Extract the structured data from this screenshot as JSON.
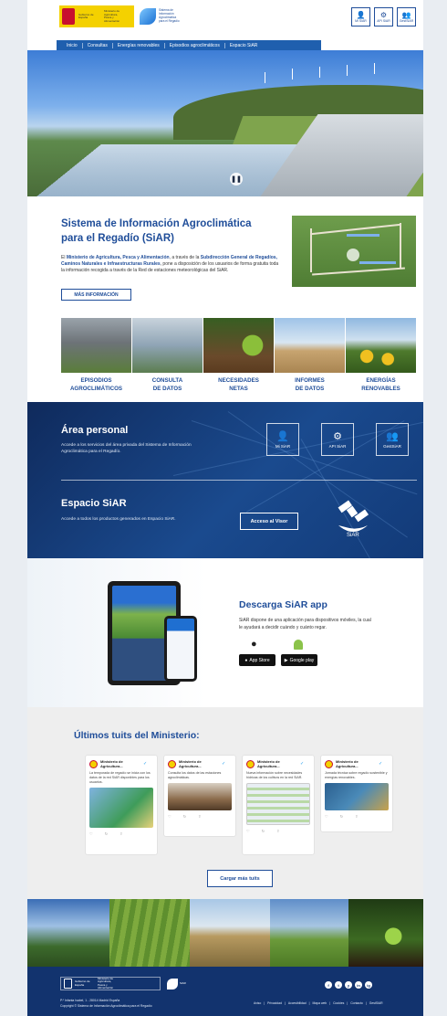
{
  "header": {
    "gov_logo_text": "Gobierno de España",
    "ministry_text": "Ministerio de Agricultura, Pesca y Alimentación",
    "siar_logo_text": "Sistema de Información Agroclimática para el Regadío",
    "buttons": [
      {
        "icon": "user-icon",
        "label": "Mi SiAR"
      },
      {
        "icon": "api-icon",
        "label": "API SiAR"
      },
      {
        "icon": "group-icon",
        "label": "GestSiAR"
      }
    ]
  },
  "nav": {
    "items": [
      "Inicio",
      "Consultas",
      "Energías renovables",
      "Episodios agroclimáticos",
      "Espacio SiAR"
    ]
  },
  "intro": {
    "title": "Sistema de Información Agroclimática para el Regadío (SiAR)",
    "text_parts": [
      "El ",
      "Ministerio de Agricultura, Pesca y Alimentación",
      ", a través de la ",
      "Subdirección General de Regadíos, Caminos Naturales e Infraestructuras Rurales",
      ", pone a disposición de los usuarios de forma gratuita toda la información recogida a través de la Red de estaciones meteorológicas del SiAR."
    ],
    "more_button": "MÁS INFORMACIÓN"
  },
  "categories": [
    {
      "label1": "EPISODIOS",
      "label2": "AGROCLIMÁTICOS"
    },
    {
      "label1": "CONSULTA",
      "label2": "DE DATOS"
    },
    {
      "label1": "NECESIDADES",
      "label2": "NETAS"
    },
    {
      "label1": "INFORMES",
      "label2": "DE DATOS"
    },
    {
      "label1": "ENERGÍAS",
      "label2": "RENOVABLES"
    }
  ],
  "area_personal": {
    "title": "Área personal",
    "description": "Accede a los servicios del área privada del Sistema de Información Agroclimática para el Regadío.",
    "buttons": [
      {
        "icon": "user-icon",
        "label": "Mi SiAR"
      },
      {
        "icon": "api-icon",
        "label": "API SiAR"
      },
      {
        "icon": "group-icon",
        "label": "GestSiAR"
      }
    ]
  },
  "espacio": {
    "title": "Espacio SiAR",
    "description": "Accede a todos los productos generados en Espacio SiAR.",
    "button": "Acceso al Visor",
    "sat_text": "SiAR"
  },
  "app": {
    "title": "Descarga SiAR app",
    "description": "SiAR dispone de una aplicación para dispositivos móviles, la cual le ayudará a decidir cuándo y cuánto regar.",
    "app_store": "App Store",
    "google_play": "Google play"
  },
  "tweets": {
    "title": "Últimos tuits del Ministerio:",
    "items": [
      {
        "author": "Ministerio de Agricultura...",
        "text": "La temporada de regadío se inicia con los datos de la red SiAR disponibles para los usuarios."
      },
      {
        "author": "Ministerio de Agricultura...",
        "text": "Consulta los datos de las estaciones agroclimáticas."
      },
      {
        "author": "Ministerio de Agricultura...",
        "text": "Nueva información sobre necesidades hídricas de los cultivos en la red SiAR."
      },
      {
        "author": "Ministerio de Agricultura...",
        "text": "Jornada técnica sobre regadío sostenible y energías renovables."
      }
    ],
    "load_more": "Cargar más tuits"
  },
  "footer": {
    "gov_text": "Gobierno de España",
    "ministry_text": "Ministerio de Agricultura, Pesca y Alimentación",
    "siar_text": "SiAR",
    "social": [
      "f",
      "t",
      "y",
      "in",
      "ig"
    ],
    "address": "P.º Infanta Isabel, 1 - 28014 Madrid España",
    "copyright": "Copyright © Sistema de Información Agroclimática para el Regadío",
    "links": [
      "Aviso",
      "Privacidad",
      "Accesibilidad",
      "Mapa web",
      "Cookies",
      "Contacto",
      "GestSiAR"
    ]
  },
  "colors": {
    "brand_blue": "#1f4d99",
    "nav_blue": "#1f5fae",
    "band_blue": "#1a4a8e",
    "footer_blue": "#12336e"
  }
}
